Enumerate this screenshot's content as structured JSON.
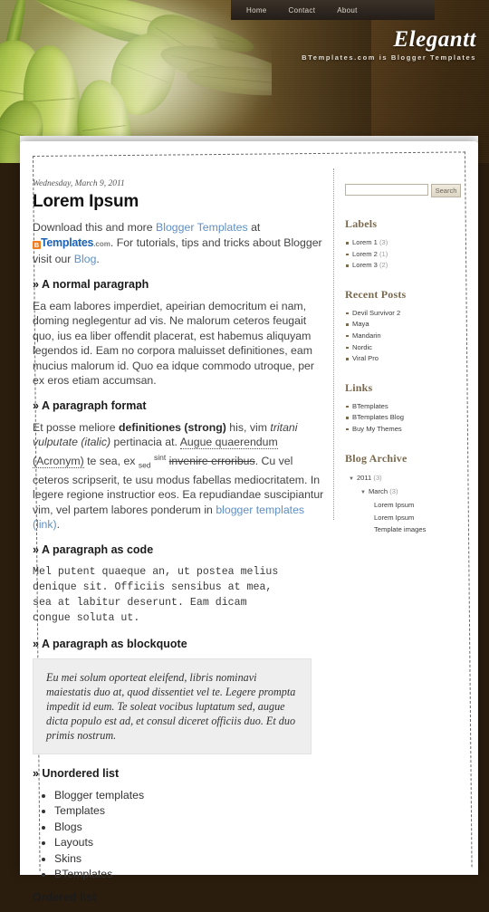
{
  "header": {
    "nav": [
      {
        "label": "Home"
      },
      {
        "label": "Contact"
      },
      {
        "label": "About"
      }
    ],
    "title": "Elegantt",
    "description": "BTemplates.com is Blogger Templates"
  },
  "post": {
    "date": "Wednesday, March 9, 2011",
    "title": "Lorem Ipsum",
    "intro": {
      "before_link": "Download this and more ",
      "link": "Blogger Templates",
      "after_link": " at ",
      "logo_b": "B",
      "logo_text": "Templates",
      "logo_com": ".com",
      "mid": ". For tutorials, tips and tricks about Blogger visit our ",
      "blog_link": "Blog",
      "end": "."
    },
    "sections": [
      {
        "heading": "» A normal paragraph",
        "body": "Ea eam labores imperdiet, apeirian democritum ei nam, doming neglegentur ad vis. Ne malorum ceteros feugait quo, ius ea liber offendit placerat, est habemus aliquyam legendos id. Eam no corpora maluisset definitiones, eam mucius malorum id. Quo ea idque commodo utroque, per ex eros etiam accumsan."
      },
      {
        "heading": "» A paragraph format"
      },
      {
        "heading": "» A paragraph as code",
        "code": "Mel putent quaeque an, ut postea melius\ndenique sit. Officiis sensibus at mea,\nsea at labitur deserunt. Eam dicam\ncongue soluta ut."
      },
      {
        "heading": "» A paragraph as blockquote",
        "quote": "Eu mei solum oporteat eleifend, libris nominavi maiestatis duo at, quod dissentiet vel te. Legere prompta impedit id eum. Te soleat vocibus luptatum sed, augue dicta populo est ad, et consul diceret officiis duo. Et duo primis nostrum."
      },
      {
        "heading": "» Unordered list"
      },
      {
        "heading": "Ordered list"
      }
    ],
    "format_paragraph": {
      "t1": "Et posse meliore ",
      "strong": "definitiones (strong)",
      "t2": " his, vim ",
      "italic": "tritani vulputate (italic)",
      "t3": " pertinacia at. ",
      "acronym_link": "Augue quaerendum (Acronym)",
      "t4": " te sea, ex ",
      "sub": "sed",
      "t5": " ",
      "sup": "sint",
      "t6": " ",
      "strike": "invenire erroribus",
      "t7": ". Cu vel ceteros scripserit, te usu modus fabellas mediocritatem. In legere regione instructior eos. Ea repudiandae suscipiantur vim, vel partem labores ponderum in ",
      "link": "blogger templates (link)",
      "t8": "."
    },
    "unordered_list": [
      "Blogger templates",
      "Templates",
      "Blogs",
      "Layouts",
      "Skins",
      "BTemplates"
    ]
  },
  "sidebar": {
    "search": {
      "value": "",
      "placeholder": "",
      "button_label": "Search"
    },
    "labels": {
      "title": "Labels",
      "items": [
        {
          "label": "Lorem 1",
          "count": "(3)"
        },
        {
          "label": "Lorem 2",
          "count": "(1)"
        },
        {
          "label": "Lorem 3",
          "count": "(2)"
        }
      ]
    },
    "recent_posts": {
      "title": "Recent Posts",
      "items": [
        {
          "label": "Devil Survivor 2"
        },
        {
          "label": "Maya"
        },
        {
          "label": "Mandarin"
        },
        {
          "label": "Nordic"
        },
        {
          "label": "Viral Pro"
        }
      ]
    },
    "links": {
      "title": "Links",
      "items": [
        {
          "label": "BTemplates"
        },
        {
          "label": "BTemplates Blog"
        },
        {
          "label": "Buy My Themes"
        }
      ]
    },
    "blog_archive": {
      "title": "Blog Archive",
      "tree": [
        {
          "level": 1,
          "marker": "▼",
          "label": "2011",
          "count": "(3)"
        },
        {
          "level": 2,
          "marker": "▼",
          "label": "March",
          "count": "(3)"
        },
        {
          "level": 3,
          "marker": "",
          "label": "Lorem Ipsum",
          "count": ""
        },
        {
          "level": 3,
          "marker": "",
          "label": "Lorem Ipsum",
          "count": ""
        },
        {
          "level": 3,
          "marker": "",
          "label": "Template images",
          "count": ""
        }
      ]
    }
  },
  "colors": {
    "accent_brown": "#7a6a4f",
    "link_blue": "#5f8fc4",
    "logo_orange": "#f07c1e",
    "logo_blue": "#1b62b5"
  }
}
